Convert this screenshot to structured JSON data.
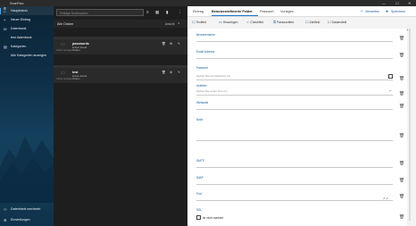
{
  "window": {
    "title": "SmartPass",
    "minimize": "—",
    "maximize": "☐",
    "close": "✕"
  },
  "sidebar": {
    "menu_icon": "≡",
    "items": [
      {
        "label": "Hauptmenü",
        "icon": "⌂"
      },
      {
        "label": "Neuer Eintrag",
        "icon": "+"
      },
      {
        "label": "Datenbank",
        "icon": "⛁"
      },
      {
        "label": "test datenbank",
        "icon": ""
      },
      {
        "label": "Kategorien",
        "icon": "▤"
      },
      {
        "label": "Alle Kategorien anzeigen",
        "icon": ""
      },
      {
        "label": "Datenbank wechseln",
        "icon": "⚇"
      },
      {
        "label": "Einstellungen",
        "icon": "⚙"
      }
    ]
  },
  "middle": {
    "search_placeholder": "Einträge Durchsuchen",
    "toolbar_icons": {
      "list": "≡",
      "grid": "▦",
      "copy": "▮",
      "more": "⋮"
    },
    "sort_label": "Alle Ordner",
    "sort_option": "Ansicht",
    "sort_chevron": "∨",
    "entries": [
      {
        "folder_text": "Ordner Anzeigen",
        "name": "passwords",
        "line2": "keinen Email",
        "line3": "Ordner"
      },
      {
        "folder_text": "Ordner Anzeigen",
        "name": "test",
        "line2": "keinen Email",
        "line3": "Ordner"
      }
    ],
    "entry_icons": {
      "delete": "🗑",
      "settings": "⚙",
      "edit": "✎"
    }
  },
  "detail": {
    "tabs": [
      "Eintrag",
      "Benutzerdefinierte Felder",
      "Passwort",
      "Vorlagen"
    ],
    "active_tab": 1,
    "top_actions": {
      "discard": "Verwerfen",
      "discard_icon": "↶",
      "save": "Speichern",
      "save_icon": "✚"
    },
    "format_buttons": [
      {
        "label": "Textfeld",
        "icon": "☐"
      },
      {
        "label": "Hinzufügen",
        "icon": "▭"
      },
      {
        "label": "Checkfeld",
        "icon": "✓"
      },
      {
        "label": "Passwortfeld",
        "icon": "⚿"
      },
      {
        "label": "Zahlfeld",
        "icon": "☐"
      },
      {
        "label": "Datumsfeld",
        "icon": "☐"
      }
    ],
    "fields": [
      {
        "label": "Benutzername",
        "value": "",
        "icon": "🗑"
      },
      {
        "label": "Email Adresse",
        "value": "",
        "icon": "🗑"
      },
      {
        "label": "Passwort",
        "value": "Geben Sie ein Passwort ein",
        "icon": "🗑"
      },
      {
        "label": "Anbieter",
        "value": "Geben Sie einen Text ein",
        "icon": "🗑"
      },
      {
        "label": "Webseite",
        "value": "",
        "icon": "🗑"
      },
      {
        "label": "Notiz",
        "value": "",
        "icon": "🗑"
      },
      {
        "label": "SMTP",
        "value": "",
        "icon": "🗑"
      },
      {
        "label": "IMAP",
        "value": "",
        "icon": "🗑"
      },
      {
        "label": "Port",
        "value": "",
        "icon": "🗑"
      },
      {
        "label": "SSL",
        "value": "",
        "icon": "🗑"
      }
    ],
    "ssl_checkbox_label": "ist nicht markiert",
    "port_stepper": "∧ ∨"
  }
}
